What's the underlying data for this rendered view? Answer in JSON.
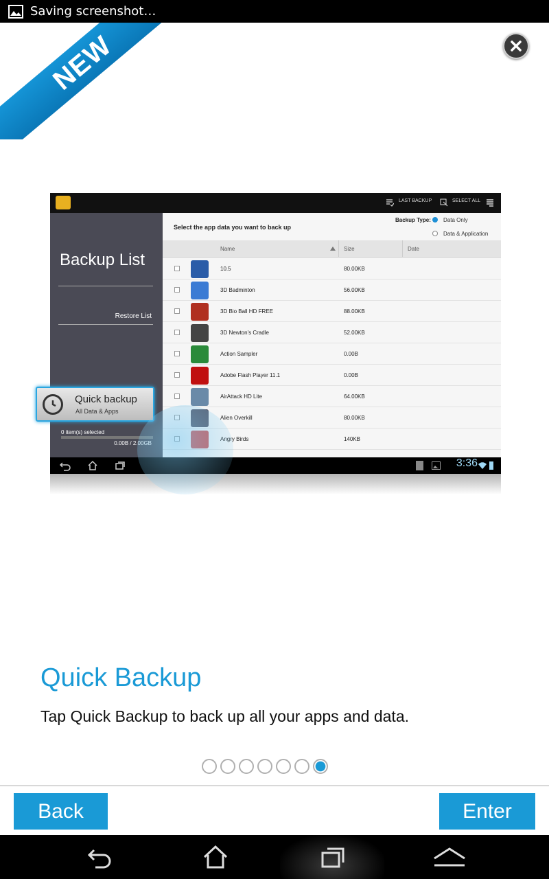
{
  "status_bar": {
    "text": "Saving screenshot…"
  },
  "ribbon": {
    "label": "NEW"
  },
  "preview": {
    "topbar": {
      "last_backup": "LAST BACKUP",
      "select_all": "SELECT ALL"
    },
    "sidebar": {
      "title": "Backup List",
      "restore": "Restore List",
      "selected_count": "0 item(s) selected",
      "selected_size": "0.00B / 2.00GB"
    },
    "main": {
      "instruction": "Select the app data you want to back up",
      "backup_type_label": "Backup Type:",
      "options": [
        "Data Only",
        "Data & Application"
      ],
      "columns": [
        "Name",
        "Size",
        "Date"
      ],
      "rows": [
        {
          "name": "10.5",
          "size": "80.00KB"
        },
        {
          "name": "3D Badminton",
          "size": "56.00KB"
        },
        {
          "name": "3D Bio Ball HD FREE",
          "size": "88.00KB"
        },
        {
          "name": "3D Newton's Cradle",
          "size": "52.00KB"
        },
        {
          "name": "Action Sampler",
          "size": "0.00B"
        },
        {
          "name": "Adobe Flash Player 11.1",
          "size": "0.00B"
        },
        {
          "name": "AirAttack HD Lite",
          "size": "64.00KB"
        },
        {
          "name": "Alien Overkill",
          "size": "80.00KB"
        },
        {
          "name": "Angry Birds",
          "size": "140KB"
        }
      ]
    },
    "quick_backup": {
      "title": "Quick backup",
      "subtitle": "All Data & Apps"
    },
    "clock": "3:36"
  },
  "content": {
    "title": "Quick Backup",
    "description": "Tap Quick Backup to back up all your apps and data."
  },
  "pager": {
    "total": 7,
    "active": 7
  },
  "buttons": {
    "back": "Back",
    "enter": "Enter"
  },
  "colors": {
    "accent": "#1a9ad6"
  }
}
